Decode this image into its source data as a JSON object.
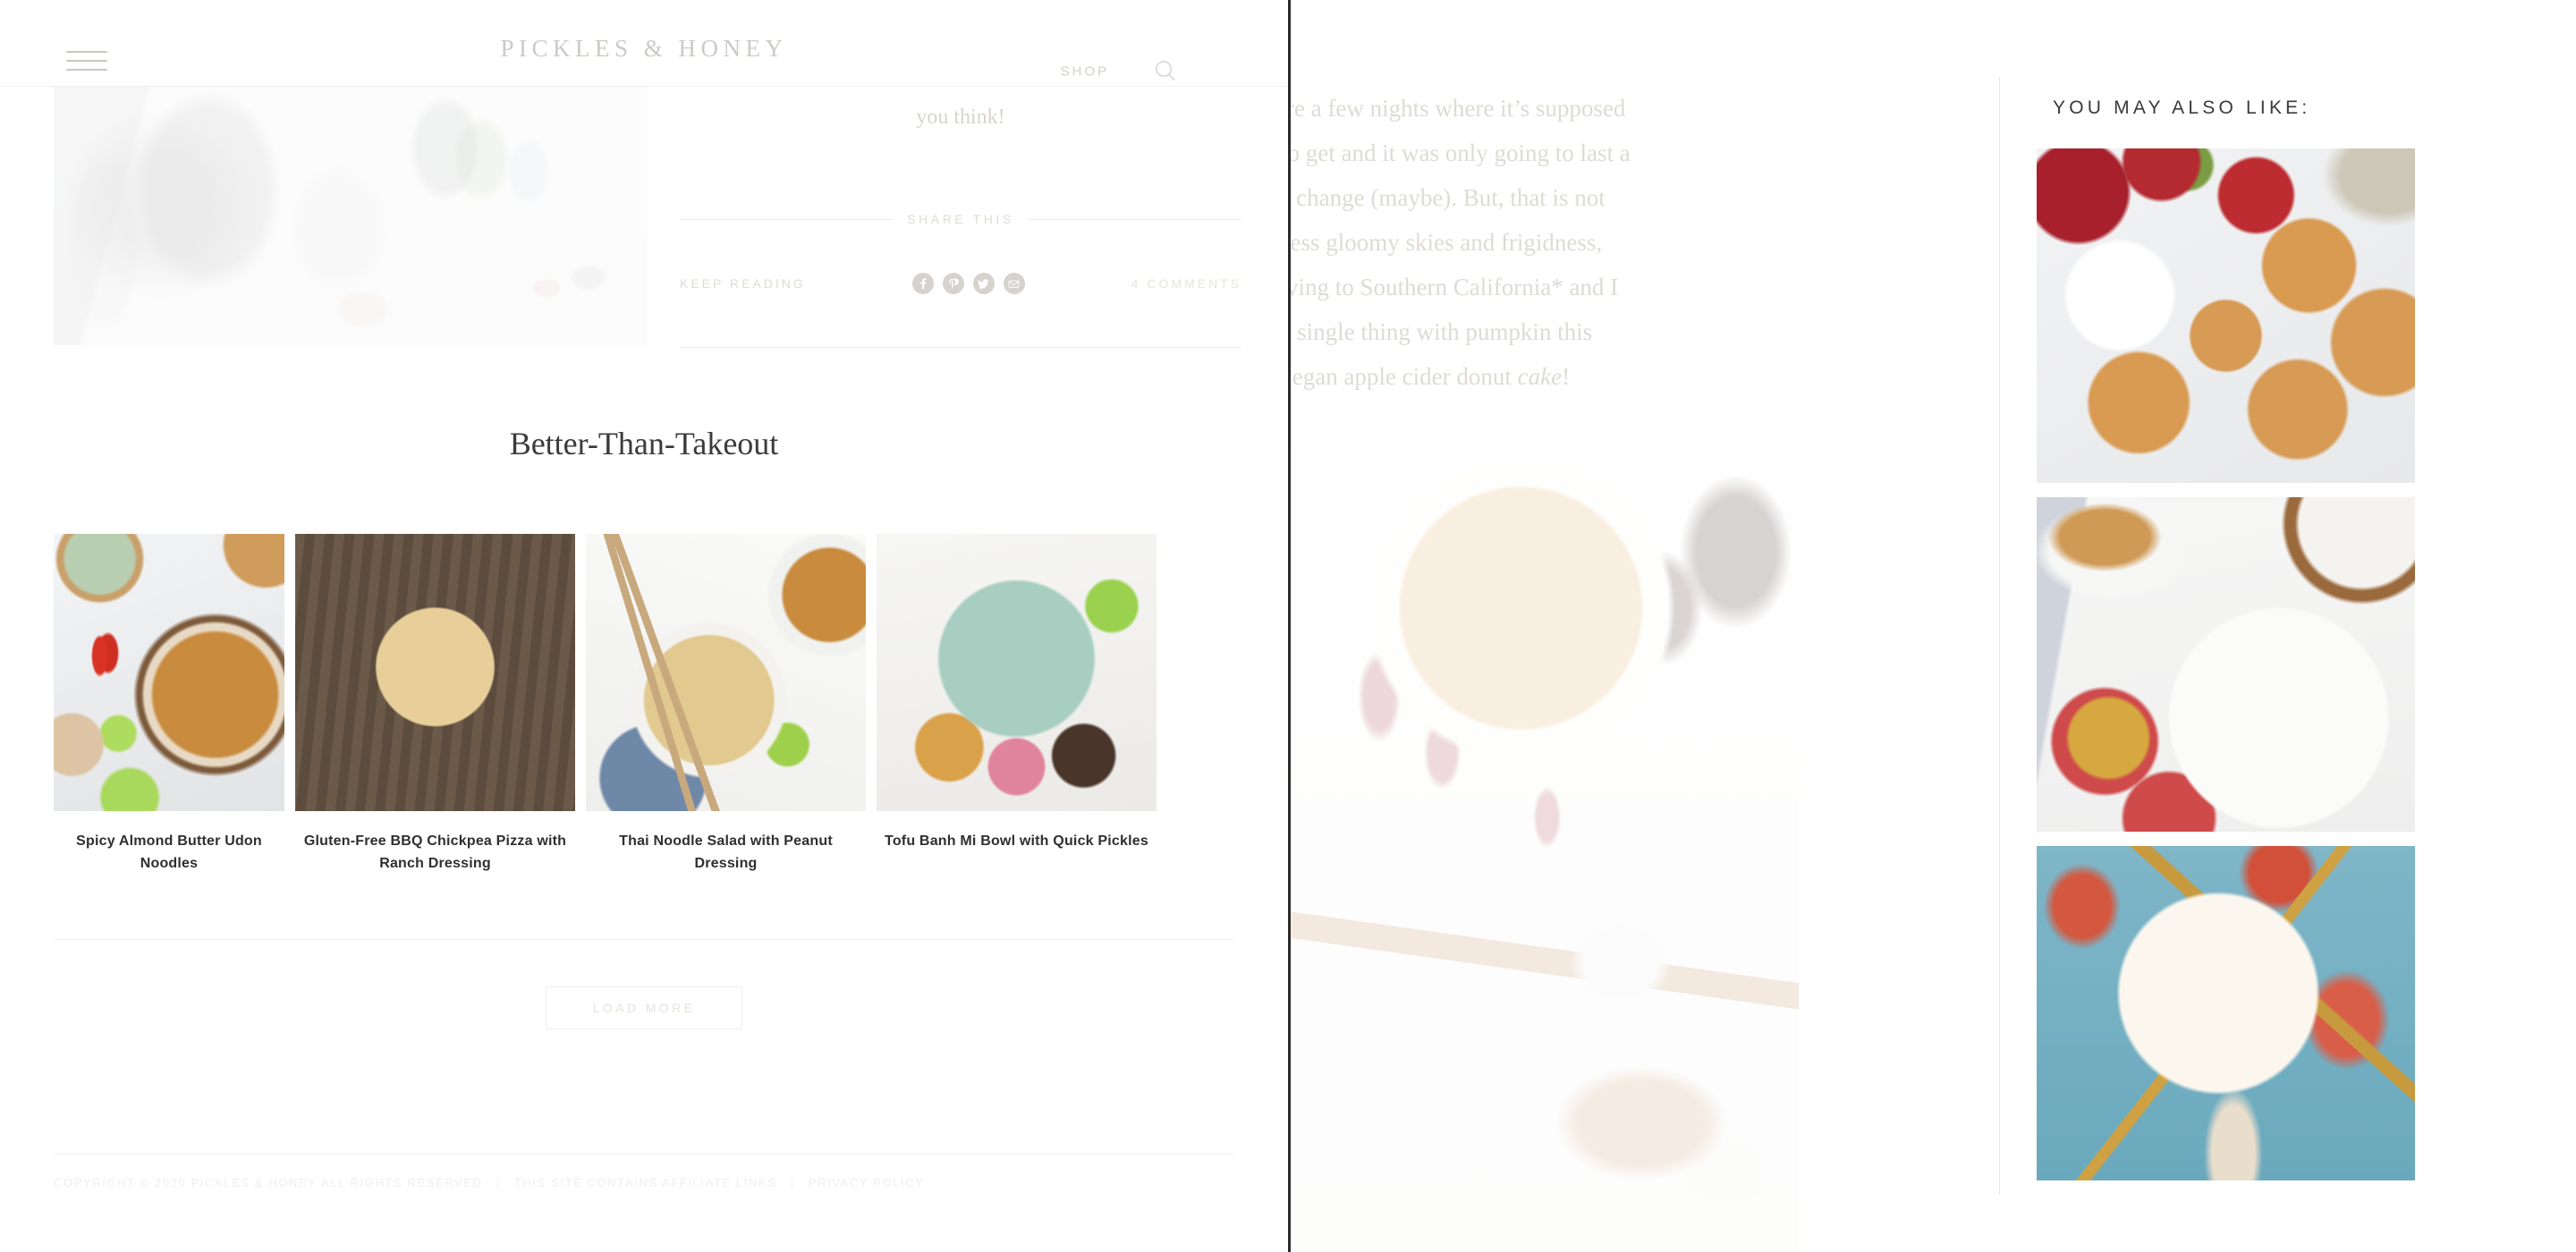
{
  "header": {
    "logo": "PICKLES & HONEY",
    "shop_label": "SHOP",
    "menu_icon": "hamburger-icon",
    "search_icon": "search-icon"
  },
  "feed": {
    "excerpt_tail": "you think!",
    "share_label": "SHARE THIS",
    "keep_reading_label": "KEEP READING",
    "comments_label": "4 COMMENTS",
    "social": [
      {
        "name": "facebook-icon",
        "glyph": "f"
      },
      {
        "name": "pinterest-icon",
        "glyph": "P"
      },
      {
        "name": "twitter-icon",
        "glyph": "t"
      },
      {
        "name": "email-icon",
        "glyph": "✉"
      }
    ],
    "category_title": "Better-Than-Takeout",
    "recipes": [
      {
        "title": "Spicy Almond Butter Udon Noodles",
        "photo": "udon-noodle-bowl"
      },
      {
        "title": "Gluten-Free BBQ Chickpea Pizza with Ranch Dressing",
        "photo": "bbq-chickpea-pizza"
      },
      {
        "title": "Thai Noodle Salad with Peanut Dressing",
        "photo": "thai-noodle-salad"
      },
      {
        "title": "Tofu Banh Mi Bowl with Quick Pickles",
        "photo": "tofu-banh-mi-bowl"
      }
    ],
    "load_more_label": "LOAD MORE"
  },
  "footer": {
    "copyright": "COPYRIGHT © 2020 PICKLES & HONEY ALL RIGHTS RESERVED",
    "affiliate": "THIS SITE CONTAINS AFFILIATE LINKS",
    "privacy": "PRIVACY POLICY",
    "separator": "|"
  },
  "post": {
    "body_lines": [
      "ng, and there are a few nights where it’s supposed",
      "t it was going to get and it was only going to last a",
      "en embrace the change (maybe). But, that is not",
      "onths of relentless gloomy skies and frigidness,",
      "talks about moving to Southern California* and I",
      "haven’t made a single thing with pumpkin this",
      "did make this vegan apple cider donut cake!"
    ],
    "body_italic_word": "cake",
    "hero_photo": "mug-of-cider-with-autumn-leaves"
  },
  "related": {
    "title": "YOU MAY ALSO LIKE:",
    "items": [
      {
        "photo": "apple-cider-donuts-with-cider-and-apples"
      },
      {
        "photo": "apple-cake-with-whipped-cream-and-apples"
      },
      {
        "photo": "caramel-apple-latte-with-whipped-cream"
      }
    ]
  },
  "colors": {
    "page_background": "#ffffff",
    "logo_gray": "#cdcac6",
    "heading_dark": "#3a3a3a",
    "muted_text": "#e0dcd4",
    "rule": "#eeebe5",
    "social_bubble": "#d6d3ce",
    "window_edge": "#2c2c2c"
  }
}
